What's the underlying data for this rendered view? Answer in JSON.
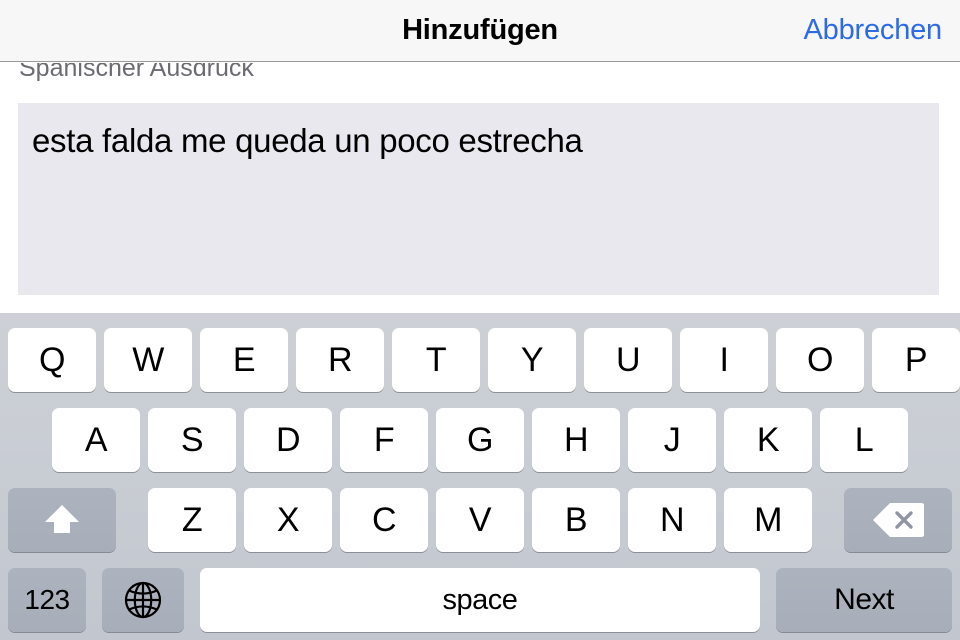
{
  "navbar": {
    "title": "Hinzufügen",
    "cancel_label": "Abbrechen",
    "cancel_color": "#2d6ae8"
  },
  "form": {
    "field_label": "Spanischer Ausdruck",
    "input_value": "esta falda me queda un poco estrecha",
    "input_placeholder": "",
    "input_background": "#e9e8ee"
  },
  "keyboard": {
    "layout": "QWERTY",
    "background": "#c8ccd3",
    "key_background": "#ffffff",
    "modifier_background": "#adb3be",
    "row1": [
      "Q",
      "W",
      "E",
      "R",
      "T",
      "Y",
      "U",
      "I",
      "O",
      "P"
    ],
    "row2": [
      "A",
      "S",
      "D",
      "F",
      "G",
      "H",
      "J",
      "K",
      "L"
    ],
    "row3": [
      "Z",
      "X",
      "C",
      "V",
      "B",
      "N",
      "M"
    ],
    "shift_icon": "shift-arrow-icon",
    "backspace_icon": "backspace-delete-icon",
    "numbers_label": "123",
    "globe_icon": "globe-icon",
    "space_label": "space",
    "return_label": "Next"
  }
}
